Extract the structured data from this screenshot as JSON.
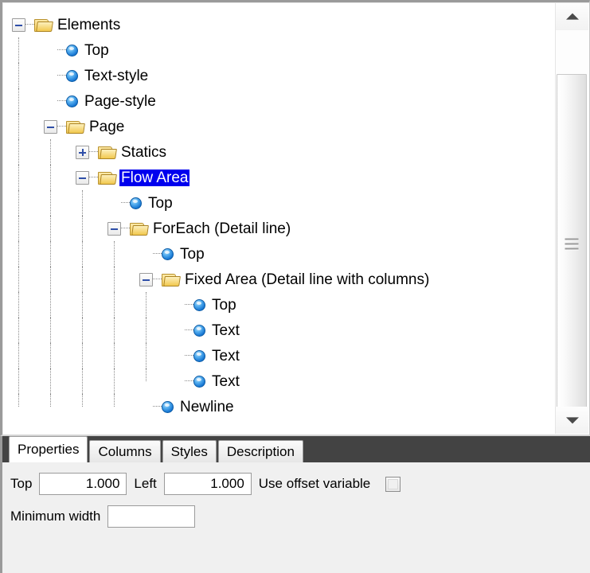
{
  "tree": {
    "name": "elements-tree",
    "nodes": [
      {
        "label": "Elements",
        "depth": 0,
        "icon": "folder-icon",
        "toggle": "minus",
        "selected": false
      },
      {
        "label": "Top",
        "depth": 1,
        "icon": "blue-sphere-icon",
        "toggle": "none",
        "selected": false
      },
      {
        "label": "Text-style",
        "depth": 1,
        "icon": "blue-sphere-icon",
        "toggle": "none",
        "selected": false
      },
      {
        "label": "Page-style",
        "depth": 1,
        "icon": "blue-sphere-icon",
        "toggle": "none",
        "selected": false
      },
      {
        "label": "Page",
        "depth": 1,
        "icon": "folder-icon",
        "toggle": "minus",
        "selected": false
      },
      {
        "label": "Statics",
        "depth": 2,
        "icon": "folder-icon",
        "toggle": "plus",
        "selected": false
      },
      {
        "label": "Flow Area",
        "depth": 2,
        "icon": "folder-icon",
        "toggle": "minus",
        "selected": true
      },
      {
        "label": "Top",
        "depth": 3,
        "icon": "blue-sphere-icon",
        "toggle": "none",
        "selected": false
      },
      {
        "label": "ForEach (Detail line)",
        "depth": 3,
        "icon": "folder-icon",
        "toggle": "minus",
        "selected": false
      },
      {
        "label": "Top",
        "depth": 4,
        "icon": "blue-sphere-icon",
        "toggle": "none",
        "selected": false
      },
      {
        "label": "Fixed Area (Detail line with columns)",
        "depth": 4,
        "icon": "folder-icon",
        "toggle": "minus",
        "selected": false
      },
      {
        "label": "Top",
        "depth": 5,
        "icon": "blue-sphere-icon",
        "toggle": "none",
        "selected": false
      },
      {
        "label": "Text",
        "depth": 5,
        "icon": "blue-sphere-icon",
        "toggle": "none",
        "selected": false
      },
      {
        "label": "Text",
        "depth": 5,
        "icon": "blue-sphere-icon",
        "toggle": "none",
        "selected": false
      },
      {
        "label": "Text",
        "depth": 5,
        "icon": "blue-sphere-icon",
        "toggle": "none",
        "selected": false
      },
      {
        "label": "Newline",
        "depth": 4,
        "icon": "blue-sphere-icon",
        "toggle": "none",
        "selected": false
      }
    ]
  },
  "scrollbar": {
    "up_arrow": "scroll-up-arrow-icon",
    "down_arrow": "scroll-down-arrow-icon",
    "thumb": "scroll-thumb"
  },
  "tabs": [
    {
      "label": "Properties",
      "active": true
    },
    {
      "label": "Columns",
      "active": false
    },
    {
      "label": "Styles",
      "active": false
    },
    {
      "label": "Description",
      "active": false
    }
  ],
  "properties": {
    "top_label": "Top",
    "top_value": "1.000",
    "left_label": "Left",
    "left_value": "1.000",
    "use_offset_label": "Use offset variable",
    "use_offset_checked": false,
    "min_width_label": "Minimum width",
    "min_width_value": "",
    "min_width_placeholder": ""
  },
  "colors": {
    "selection": "#0000ee",
    "tabstrip_bg": "#434343",
    "panel_bg": "#f0f0f0"
  }
}
